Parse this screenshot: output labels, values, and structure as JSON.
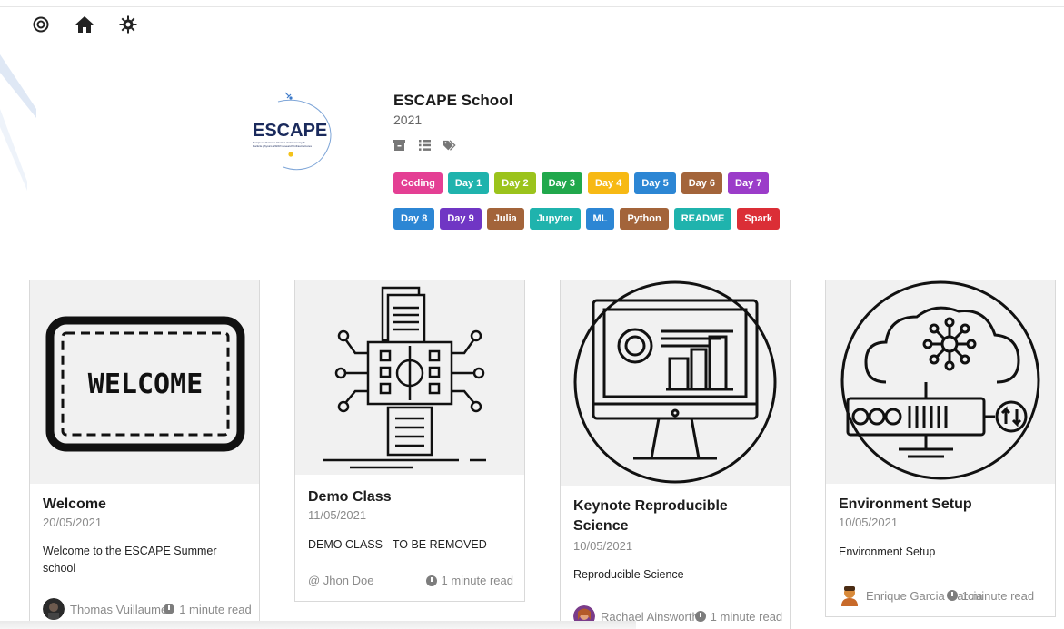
{
  "nav": {
    "icons": [
      "target-icon",
      "home-icon",
      "settings-icon"
    ]
  },
  "school": {
    "logo_text": "ESCAPE",
    "logo_subtext": "European Science Cluster of Astronomy & Particle physics ESFRI research Infrastructures",
    "title": "ESCAPE School",
    "year": "2021"
  },
  "tags_row1": [
    {
      "label": "Coding",
      "color": "#e43f94"
    },
    {
      "label": "Day 1",
      "color": "#1fb3ad"
    },
    {
      "label": "Day 2",
      "color": "#9bc31c"
    },
    {
      "label": "Day 3",
      "color": "#21a84c"
    },
    {
      "label": "Day 4",
      "color": "#f7b914"
    },
    {
      "label": "Day 5",
      "color": "#2c86d4"
    },
    {
      "label": "Day 6",
      "color": "#a3643a"
    },
    {
      "label": "Day 7",
      "color": "#9b3cc9"
    }
  ],
  "tags_row2": [
    {
      "label": "Day 8",
      "color": "#2c86d4"
    },
    {
      "label": "Day 9",
      "color": "#7036c4"
    },
    {
      "label": "Julia",
      "color": "#a3643a"
    },
    {
      "label": "Jupyter",
      "color": "#1fb3ad"
    },
    {
      "label": "ML",
      "color": "#2c86d4"
    },
    {
      "label": "Python",
      "color": "#a3643a"
    },
    {
      "label": "README",
      "color": "#1fb3ad"
    },
    {
      "label": "Spark",
      "color": "#db2e36"
    }
  ],
  "cards": [
    {
      "title": "Welcome",
      "date": "20/05/2021",
      "desc": "Welcome to the ESCAPE Summer school",
      "author": "Thomas Vuillaume",
      "readtime": "1 minute read",
      "image_text": "WELCOME"
    },
    {
      "title": "Demo Class",
      "date": "11/05/2021",
      "desc": "DEMO CLASS - TO BE REMOVED",
      "author": "@ Jhon Doe",
      "readtime": "1 minute read"
    },
    {
      "title": "Keynote Reproducible Science",
      "date": "10/05/2021",
      "desc": "Reproducible Science",
      "author": "Rachael Ainsworth",
      "readtime": "1 minute read"
    },
    {
      "title": "Environment Setup",
      "date": "10/05/2021",
      "desc": "Environment Setup",
      "author": "Enrique Garcia Garcia",
      "readtime": "1 minute read"
    }
  ]
}
